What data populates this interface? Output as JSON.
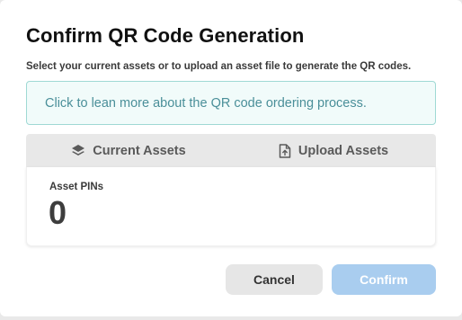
{
  "dialog": {
    "title": "Confirm QR Code Generation",
    "subtitle": "Select your current assets or to upload an asset file to generate the QR codes.",
    "info_link": "Click to lean more about the QR code ordering process."
  },
  "tabs": [
    {
      "label": "Current Assets",
      "icon": "layers-icon"
    },
    {
      "label": "Upload Assets",
      "icon": "file-upload-icon"
    }
  ],
  "panel": {
    "label": "Asset PINs",
    "value": "0"
  },
  "buttons": {
    "cancel": "Cancel",
    "confirm": "Confirm"
  },
  "colors": {
    "info_border": "#9fd9d4",
    "info_text": "#4a8f99",
    "confirm_disabled": "#a9cdef"
  }
}
